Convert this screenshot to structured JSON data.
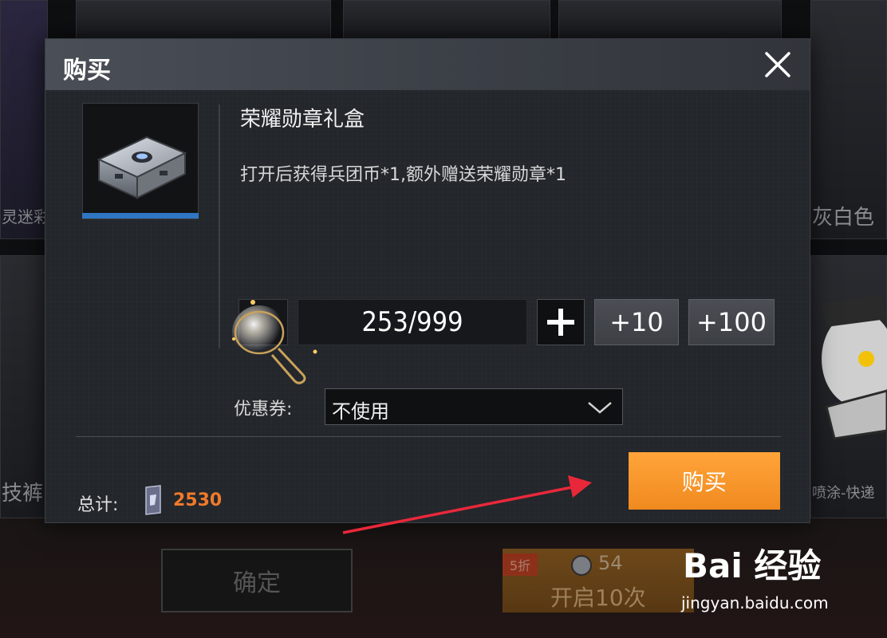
{
  "background": {
    "card_labels": [
      "灵迷彩",
      "灰白色",
      "技裤",
      "喷涂-快递"
    ],
    "confirm_label": "确定",
    "open10": {
      "badge": "5折",
      "count": "54",
      "label": "开启10次"
    }
  },
  "dialog": {
    "title": "购买",
    "item": {
      "name": "荣耀勋章礼盒",
      "description": "打开后获得兵团币*1,额外赠送荣耀勋章*1"
    },
    "quantity": {
      "value": "253/999",
      "plus_label": "+",
      "plus10_label": "+10",
      "plus100_label": "+100"
    },
    "coupon": {
      "label": "优惠券:",
      "selected": "不使用"
    },
    "total": {
      "label": "总计:",
      "value": "2530"
    },
    "buy_label": "购买"
  },
  "watermark": {
    "brand": "Bai 经验",
    "url": "jingyan.baidu.com"
  },
  "colors": {
    "accent_orange": "#f08a1f",
    "total_orange": "#f07a2b",
    "thumb_bar_blue": "#2f76c2",
    "annotation_arrow_red": "#e8283a"
  }
}
